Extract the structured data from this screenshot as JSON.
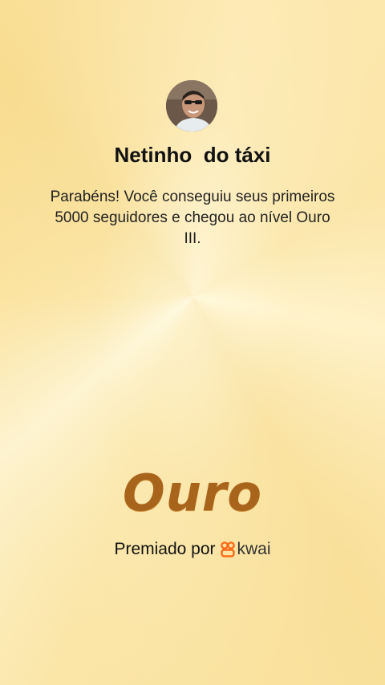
{
  "profile": {
    "name": "Netinho  do táxi",
    "avatar_icon": "user-avatar-photo"
  },
  "message": "Parabéns! Você conseguiu seus primeiros 5000 seguidores e chegou ao nível Ouro III.",
  "level": {
    "label": "Ouro",
    "color": "#a9641c"
  },
  "footer": {
    "awarded_by": "Premiado por",
    "brand_name": "kwai",
    "brand_icon": "kwai-logo-icon",
    "brand_color": "#ff6a1a"
  },
  "colors": {
    "background": "#fbe6a8"
  }
}
